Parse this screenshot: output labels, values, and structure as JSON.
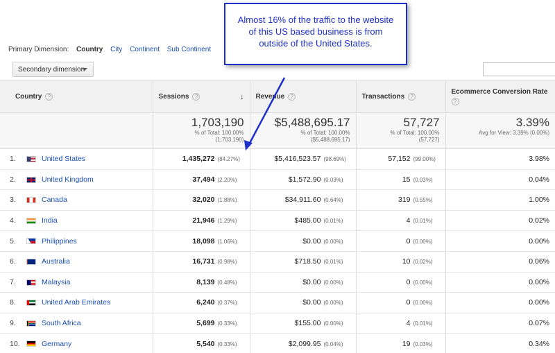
{
  "callout": {
    "text": "Almost 16% of the traffic to the website of this US based business is from outside of the United States."
  },
  "dimension_bar": {
    "label": "Primary Dimension:",
    "active": "Country",
    "options": [
      "City",
      "Continent",
      "Sub Continent"
    ]
  },
  "secondary_dimension": {
    "label": "Secondary dimension"
  },
  "search": {
    "value": ""
  },
  "columns": {
    "country": "Country",
    "sessions": "Sessions",
    "revenue": "Revenue",
    "transactions": "Transactions",
    "conversion": "Ecommerce Conversion Rate"
  },
  "totals": {
    "sessions": {
      "value": "1,703,190",
      "line1": "% of Total: 100.00%",
      "line2": "(1,703,190)"
    },
    "revenue": {
      "value": "$5,488,695.17",
      "line1": "% of Total: 100.00%",
      "line2": "($5,488,695.17)"
    },
    "transactions": {
      "value": "57,727",
      "line1": "% of Total: 100.00%",
      "line2": "(57,727)"
    },
    "conversion": {
      "value": "3.39%",
      "line1": "Avg for View: 3.39% (0.00%)"
    }
  },
  "rows": [
    {
      "rank": "1.",
      "country": "United States",
      "flag": "us-flag",
      "sessions": "1,435,272",
      "sessions_pct": "(84.27%)",
      "revenue": "$5,416,523.57",
      "revenue_pct": "(98.69%)",
      "transactions": "57,152",
      "transactions_pct": "(99.00%)",
      "conversion": "3.98%"
    },
    {
      "rank": "2.",
      "country": "United Kingdom",
      "flag": "uk-flag",
      "sessions": "37,494",
      "sessions_pct": "(2.20%)",
      "revenue": "$1,572.90",
      "revenue_pct": "(0.03%)",
      "transactions": "15",
      "transactions_pct": "(0.03%)",
      "conversion": "0.04%"
    },
    {
      "rank": "3.",
      "country": "Canada",
      "flag": "canada-flag",
      "sessions": "32,020",
      "sessions_pct": "(1.88%)",
      "revenue": "$34,911.60",
      "revenue_pct": "(0.64%)",
      "transactions": "319",
      "transactions_pct": "(0.55%)",
      "conversion": "1.00%"
    },
    {
      "rank": "4.",
      "country": "India",
      "flag": "india-flag",
      "sessions": "21,946",
      "sessions_pct": "(1.29%)",
      "revenue": "$485.00",
      "revenue_pct": "(0.01%)",
      "transactions": "4",
      "transactions_pct": "(0.01%)",
      "conversion": "0.02%"
    },
    {
      "rank": "5.",
      "country": "Philippines",
      "flag": "philippines-flag",
      "sessions": "18,098",
      "sessions_pct": "(1.06%)",
      "revenue": "$0.00",
      "revenue_pct": "(0.00%)",
      "transactions": "0",
      "transactions_pct": "(0.00%)",
      "conversion": "0.00%"
    },
    {
      "rank": "6.",
      "country": "Australia",
      "flag": "australia-flag",
      "sessions": "16,731",
      "sessions_pct": "(0.98%)",
      "revenue": "$718.50",
      "revenue_pct": "(0.01%)",
      "transactions": "10",
      "transactions_pct": "(0.02%)",
      "conversion": "0.06%"
    },
    {
      "rank": "7.",
      "country": "Malaysia",
      "flag": "malaysia-flag",
      "sessions": "8,139",
      "sessions_pct": "(0.48%)",
      "revenue": "$0.00",
      "revenue_pct": "(0.00%)",
      "transactions": "0",
      "transactions_pct": "(0.00%)",
      "conversion": "0.00%"
    },
    {
      "rank": "8.",
      "country": "United Arab Emirates",
      "flag": "uae-flag",
      "sessions": "6,240",
      "sessions_pct": "(0.37%)",
      "revenue": "$0.00",
      "revenue_pct": "(0.00%)",
      "transactions": "0",
      "transactions_pct": "(0.00%)",
      "conversion": "0.00%"
    },
    {
      "rank": "9.",
      "country": "South Africa",
      "flag": "south-africa-flag",
      "sessions": "5,699",
      "sessions_pct": "(0.33%)",
      "revenue": "$155.00",
      "revenue_pct": "(0.00%)",
      "transactions": "4",
      "transactions_pct": "(0.01%)",
      "conversion": "0.07%"
    },
    {
      "rank": "10.",
      "country": "Germany",
      "flag": "germany-flag",
      "sessions": "5,540",
      "sessions_pct": "(0.33%)",
      "revenue": "$2,099.95",
      "revenue_pct": "(0.04%)",
      "transactions": "19",
      "transactions_pct": "(0.03%)",
      "conversion": "0.34%"
    }
  ]
}
